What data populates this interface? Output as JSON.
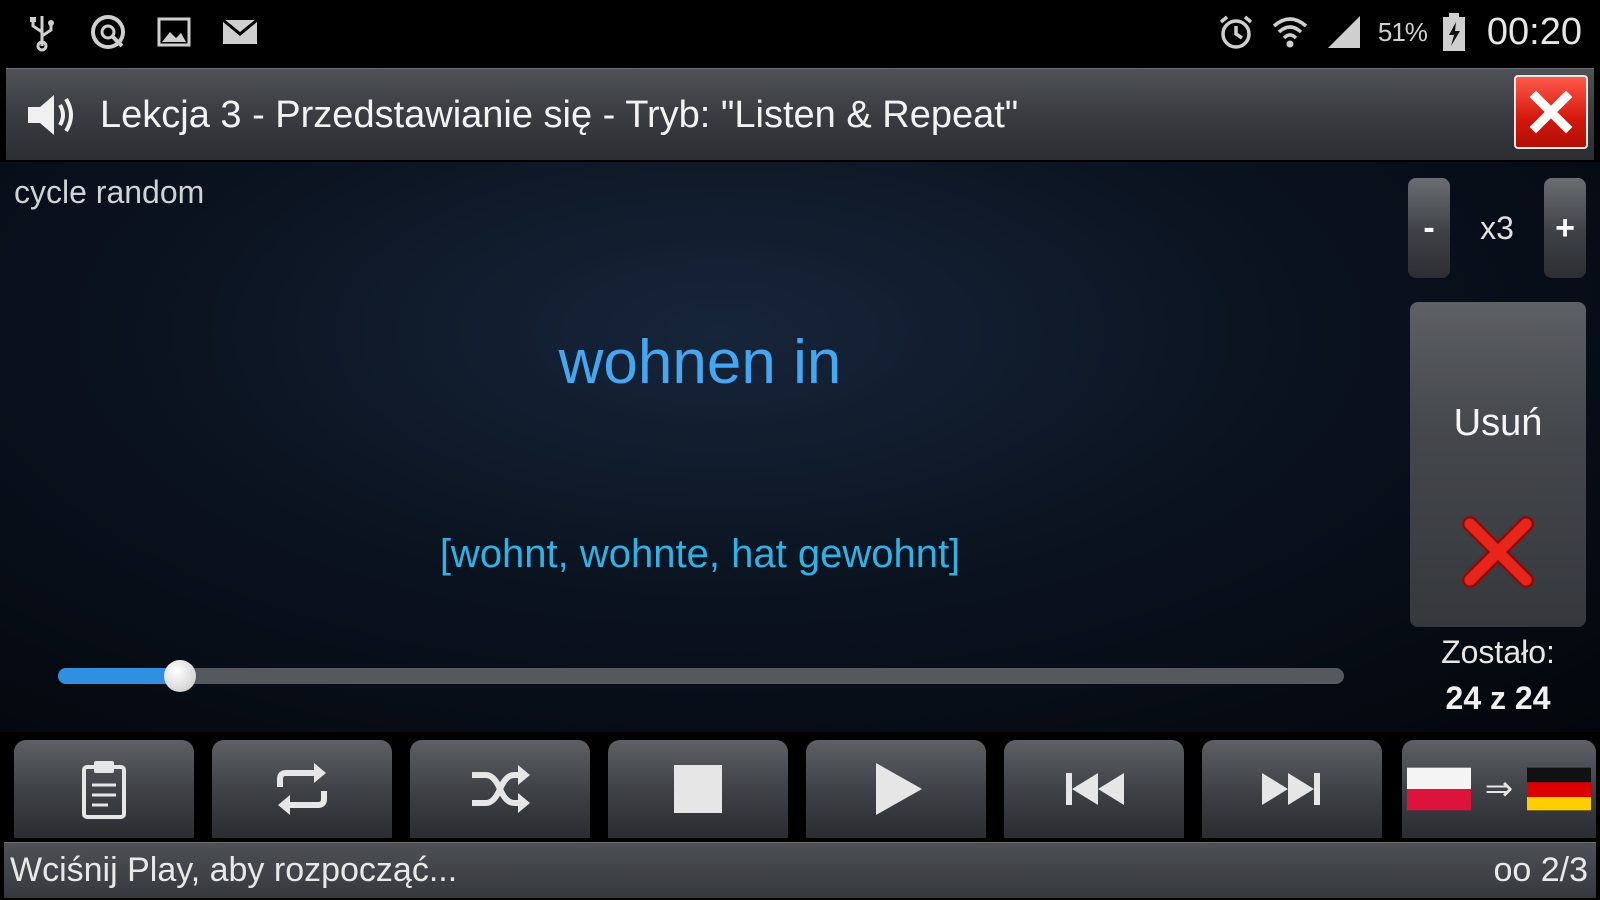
{
  "status_bar": {
    "icons_left": [
      "usb-icon",
      "data-sync-icon",
      "gallery-icon",
      "mail-icon"
    ],
    "icons_right": [
      "alarm-icon",
      "wifi-icon",
      "signal-icon",
      "battery-icon"
    ],
    "battery_percent": "51%",
    "clock": "00:20"
  },
  "title_bar": {
    "title": "Lekcja 3 - Przedstawianie się - Tryb: \"Listen & Repeat\"",
    "close_icon": "close-icon"
  },
  "main": {
    "mode_label": "cycle random",
    "word": "wohnen in",
    "forms": "[wohnt, wohnte, hat gewohnt]",
    "repeat": {
      "minus": "-",
      "value": "x3",
      "plus": "+"
    },
    "delete": {
      "label": "Usuń"
    },
    "remaining": {
      "label": "Zostało:",
      "value": "24 z 24"
    },
    "progress_fraction": 0.095
  },
  "toolbar": {
    "buttons": [
      "clipboard-icon",
      "repeat-icon",
      "shuffle-icon",
      "stop-icon",
      "play-icon",
      "previous-icon",
      "next-icon"
    ],
    "language_arrow": "⇒",
    "flags": [
      "polish-flag",
      "german-flag"
    ]
  },
  "bottom_bar": {
    "message": "Wciśnij Play, aby rozpocząć...",
    "counter": "oo 2/3"
  },
  "colors": {
    "word": "#45a6f2",
    "forms": "#2eb3e6",
    "accent_red": "#d4180c",
    "progress": "#2f8fe0"
  }
}
